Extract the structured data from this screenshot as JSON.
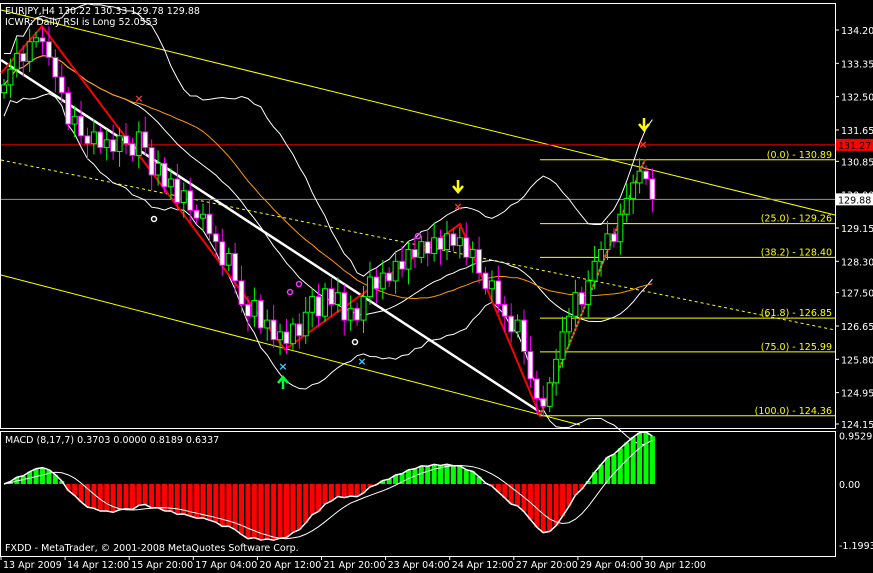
{
  "header": {
    "symbol_line": "EURJPY,H4  130.22 130.33 129.78 129.88",
    "indicator_line": "ICWR: Daily RSI is Long 52.0553"
  },
  "macd_label": "MACD  (8,17,7) 0.3703 0.0000 0.8189 0.6337",
  "footer": "FXDD - MetaTrader, © 2001-2008 MetaQuotes Software Corp.",
  "colors": {
    "bull": "#00ff00",
    "bear": "#ff00ff",
    "zigzag": "#ff0000",
    "channel": "#ffff00",
    "fib": "#ffff00",
    "ask": "#ff0000",
    "bid": "#ffffff"
  },
  "chart_data": {
    "type": "candlestick",
    "symbol": "EURJPY",
    "timeframe": "H4",
    "ylim": [
      124.15,
      134.2
    ],
    "price_ticks": [
      "134.20",
      "133.35",
      "132.50",
      "131.65",
      "130.85",
      "130.00",
      "129.15",
      "128.30",
      "127.50",
      "126.65",
      "125.80",
      "124.95",
      "124.15"
    ],
    "price_tick_values": [
      134.2,
      133.35,
      132.5,
      131.65,
      130.85,
      130.0,
      129.15,
      128.3,
      127.5,
      126.65,
      125.8,
      124.95,
      124.15
    ],
    "time_ticks": [
      "13 Apr 2009",
      "14 Apr 12:00",
      "15 Apr 20:00",
      "17 Apr 04:00",
      "20 Apr 12:00",
      "21 Apr 20:00",
      "23 Apr 04:00",
      "24 Apr 12:00",
      "27 Apr 20:00",
      "29 Apr 04:00",
      "30 Apr 12:00"
    ],
    "closes": [
      132.8,
      133.2,
      133.6,
      133.4,
      133.9,
      134.0,
      133.9,
      133.5,
      133.0,
      132.6,
      131.8,
      132.0,
      131.5,
      131.3,
      131.6,
      131.2,
      131.4,
      131.1,
      131.5,
      131.3,
      131.0,
      131.6,
      131.2,
      130.5,
      130.8,
      130.2,
      130.4,
      129.8,
      130.1,
      129.6,
      129.4,
      129.5,
      129.0,
      128.8,
      128.2,
      128.5,
      127.8,
      127.2,
      126.9,
      127.3,
      126.6,
      126.8,
      126.3,
      126.5,
      126.2,
      126.7,
      126.4,
      127.0,
      127.4,
      126.9,
      127.6,
      127.2,
      127.5,
      126.8,
      127.1,
      126.8,
      127.4,
      127.9,
      127.6,
      128.0,
      127.8,
      128.3,
      128.1,
      128.6,
      128.4,
      128.8,
      128.5,
      128.9,
      128.6,
      129.0,
      128.7,
      128.9,
      128.4,
      128.6,
      128.0,
      127.6,
      127.8,
      127.2,
      126.9,
      126.5,
      126.8,
      126.0,
      125.3,
      124.8,
      124.6,
      125.2,
      125.8,
      126.5,
      126.9,
      127.5,
      127.2,
      127.8,
      128.3,
      128.6,
      129.0,
      128.8,
      129.5,
      129.9,
      130.3,
      130.6,
      130.4,
      129.88
    ],
    "zigzag": [
      133.1,
      134.3,
      126.05,
      129.25,
      124.36,
      130.9
    ],
    "ask_price": "131.27",
    "bid_price": "129.88",
    "fibonacci": [
      {
        "label": "(0.0) - 130.89",
        "price": 130.89
      },
      {
        "label": "(25.0) - 129.26",
        "price": 129.26
      },
      {
        "label": "(38.2) - 128.40",
        "price": 128.4
      },
      {
        "label": "(61.8) - 126.85",
        "price": 126.85
      },
      {
        "label": "(75.0) - 125.99",
        "price": 125.99
      },
      {
        "label": "(100.0) - 124.36",
        "price": 124.36
      }
    ],
    "macd": {
      "params": "8,17,7",
      "ticks": [
        "0.9529",
        "0.00",
        "-1.1993"
      ],
      "tick_values": [
        0.9529,
        0,
        -1.1993
      ]
    }
  }
}
